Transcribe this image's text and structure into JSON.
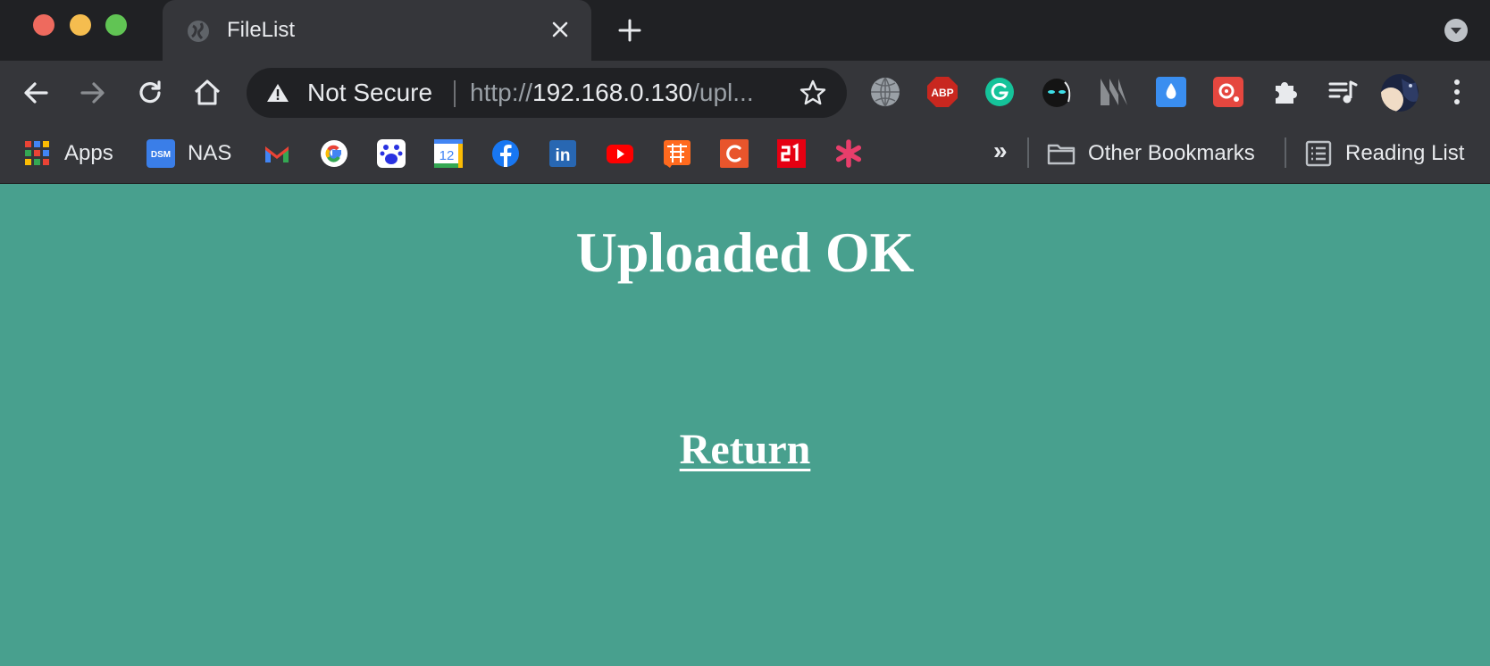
{
  "browser": {
    "tab": {
      "title": "FileList"
    },
    "omnibox": {
      "security_label": "Not Secure",
      "url_scheme": "http://",
      "url_host": "192.168.0.130",
      "url_rest": "/upl..."
    },
    "extensions": [
      "globe-extension",
      "adblock-plus",
      "grammarly",
      "dark-reader",
      "mark-extension",
      "raindrop",
      "gear-extension",
      "puzzle-extensions",
      "media-control",
      "profile-avatar"
    ],
    "bookmarks": [
      {
        "label": "Apps"
      },
      {
        "label": "NAS"
      }
    ],
    "other_bookmarks": "Other Bookmarks",
    "reading_list": "Reading List",
    "overflow_chevron": "»"
  },
  "page": {
    "heading": "Uploaded OK",
    "return_link": "Return",
    "background": "#48a08e"
  }
}
